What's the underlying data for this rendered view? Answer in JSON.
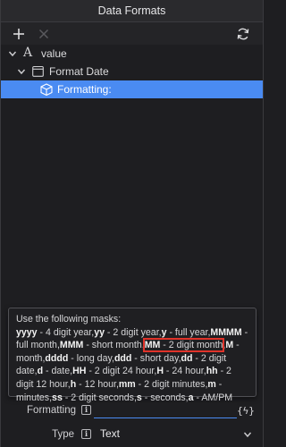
{
  "window": {
    "title": "Data Formats"
  },
  "toolbar": {
    "add_icon": "plus-icon",
    "remove_icon": "x-icon",
    "refresh_icon": "refresh-icon"
  },
  "tree": {
    "items": [
      {
        "label": "value",
        "icon": "text-type-icon",
        "expanded": true
      },
      {
        "label": "Format Date",
        "icon": "calendar-icon",
        "expanded": true
      },
      {
        "label": "Formatting:",
        "icon": "cube-icon",
        "selected": true
      }
    ]
  },
  "tooltip": {
    "title": "Use the following masks:",
    "masks": [
      {
        "code": "yyyy",
        "desc": "4 digit year"
      },
      {
        "code": "yy",
        "desc": "2 digit year"
      },
      {
        "code": "y",
        "desc": "full year"
      },
      {
        "code": "MMMM",
        "desc": "full month"
      },
      {
        "code": "MMM",
        "desc": "short month"
      },
      {
        "code": "MM",
        "desc": "2 digit month"
      },
      {
        "code": "M",
        "desc": "month"
      },
      {
        "code": "dddd",
        "desc": "long day"
      },
      {
        "code": "ddd",
        "desc": "short day"
      },
      {
        "code": "dd",
        "desc": "2 digit date"
      },
      {
        "code": "d",
        "desc": "date"
      },
      {
        "code": "HH",
        "desc": "2 digit 24 hour"
      },
      {
        "code": "H",
        "desc": "24 hour"
      },
      {
        "code": "hh",
        "desc": "2 digit 12 hour"
      },
      {
        "code": "h",
        "desc": "12 hour"
      },
      {
        "code": "mm",
        "desc": "2 digit minutes"
      },
      {
        "code": "m",
        "desc": "minutes"
      },
      {
        "code": "ss",
        "desc": "2 digit seconds"
      },
      {
        "code": "s",
        "desc": "seconds"
      },
      {
        "code": "a",
        "desc": "AM/PM"
      }
    ],
    "highlighted_index": 5,
    "highlight_color": "#e0332a"
  },
  "properties": {
    "formatting": {
      "label": "Formatting",
      "value": "",
      "expr_button": "{ϟ}"
    },
    "type": {
      "label": "Type",
      "value": "Text"
    }
  },
  "colors": {
    "accent": "#4a8bf2",
    "background": "#1e1e21"
  }
}
